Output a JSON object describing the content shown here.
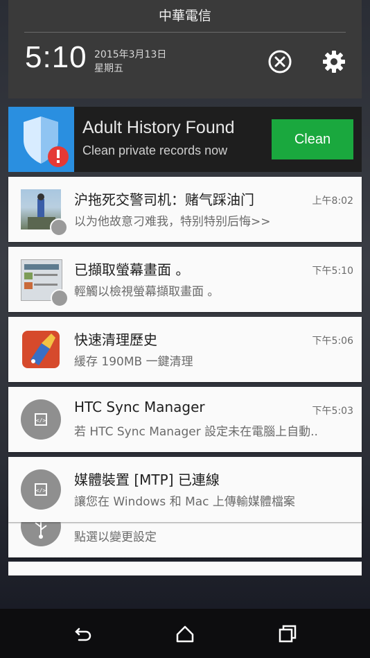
{
  "status": {
    "carrier": "中華電信",
    "time": "5:10",
    "date": "2015年3月13日",
    "weekday": "星期五"
  },
  "ad": {
    "title": "Adult History Found",
    "subtitle": "Clean private records now",
    "button_label": "Clean",
    "icon": "shield-alert-icon",
    "accent_color": "#1aa83e"
  },
  "notifications": [
    {
      "title": "沪拖死交警司机：赌气踩油门",
      "text": "以为他故意刁难我，特别特别后悔>>",
      "time": "上午8:02",
      "icon": "news-thumbnail"
    },
    {
      "title": "已擷取螢幕畫面 。",
      "text": "輕觸以檢視螢幕擷取畫面 。",
      "time": "下午5:10",
      "icon": "screenshot-thumbnail"
    },
    {
      "title": "快速清理歷史",
      "text": "緩存 190MB 一鍵清理",
      "time": "下午5:06",
      "icon": "broom-app-icon"
    },
    {
      "title": "HTC Sync Manager",
      "text": "若 HTC Sync Manager 設定未在電腦上自動..",
      "time": "下午5:03",
      "icon": "code-icon"
    },
    {
      "title": "媒體裝置 [MTP] 已連線",
      "text": "讓您在 Windows 和 Mac 上傳輸媒體檔案",
      "time": "",
      "icon": "code-icon"
    },
    {
      "title": "",
      "text": "點選以變更設定",
      "time": "",
      "icon": "usb-icon"
    }
  ],
  "navbar": {
    "back": "back-icon",
    "home": "home-icon",
    "recents": "recents-icon"
  }
}
